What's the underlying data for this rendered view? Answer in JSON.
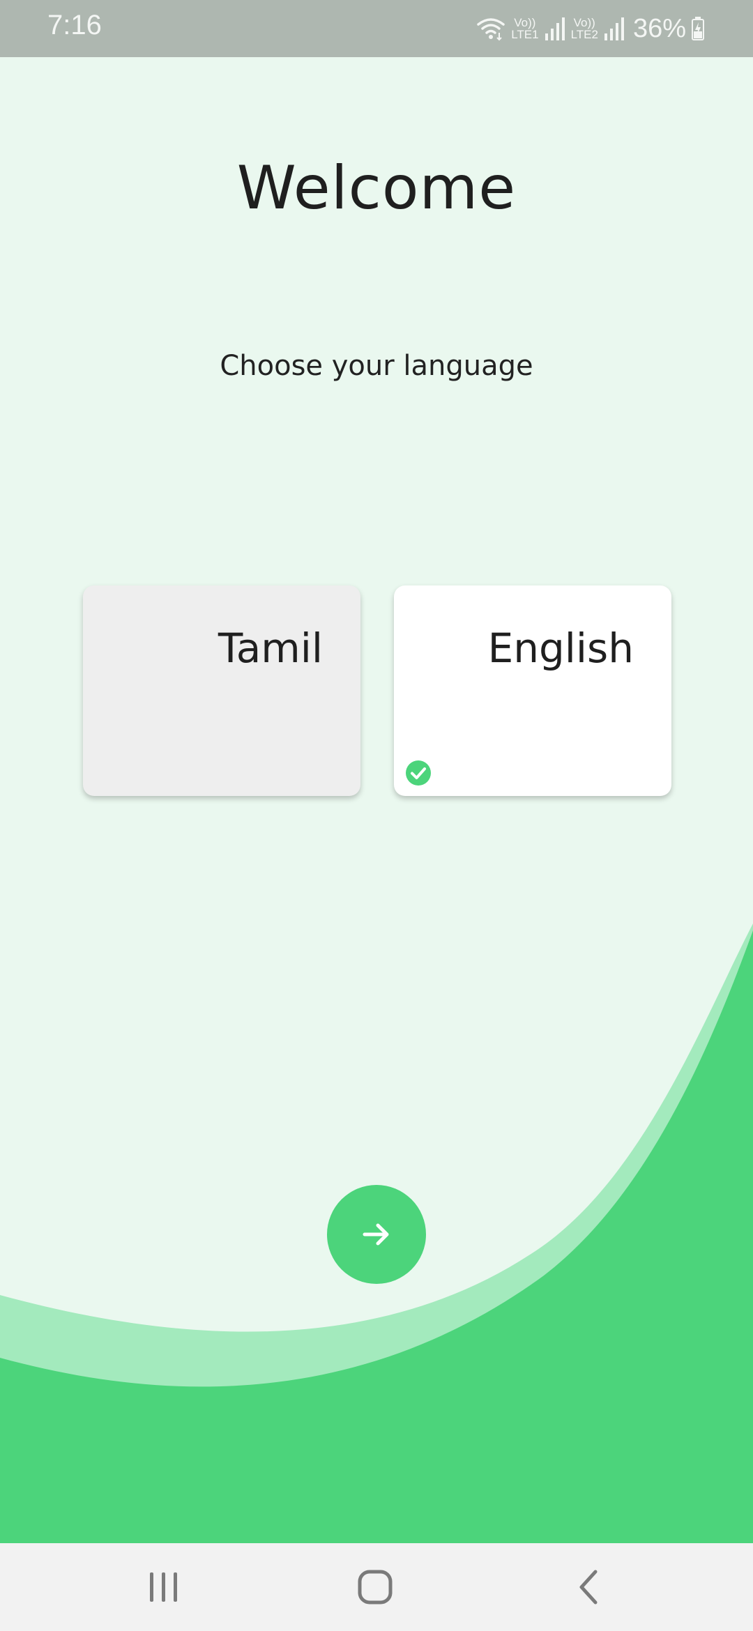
{
  "status_bar": {
    "time": "7:16",
    "battery": "36%",
    "sim1_label": "LTE1",
    "sim2_label": "LTE2",
    "volte_label": "Vo))",
    "icons": [
      "wifi-icon",
      "signal-sim1-icon",
      "signal-sim2-icon",
      "battery-charging-icon"
    ]
  },
  "header": {
    "title": "Welcome",
    "subtitle": "Choose your language"
  },
  "languages": [
    {
      "label": "Tamil",
      "selected": false
    },
    {
      "label": "English",
      "selected": true
    }
  ],
  "next_button": {
    "icon": "arrow-right-icon"
  },
  "nav_bar": {
    "icons": [
      "recent-apps-icon",
      "home-icon",
      "back-icon"
    ]
  },
  "colors": {
    "background": "#eaf8ef",
    "accent": "#4cd47b",
    "accent_light": "#a3eabd",
    "card_unselected": "#eeeeee",
    "card_selected": "#ffffff",
    "status_bar": "#aeb7b0"
  }
}
